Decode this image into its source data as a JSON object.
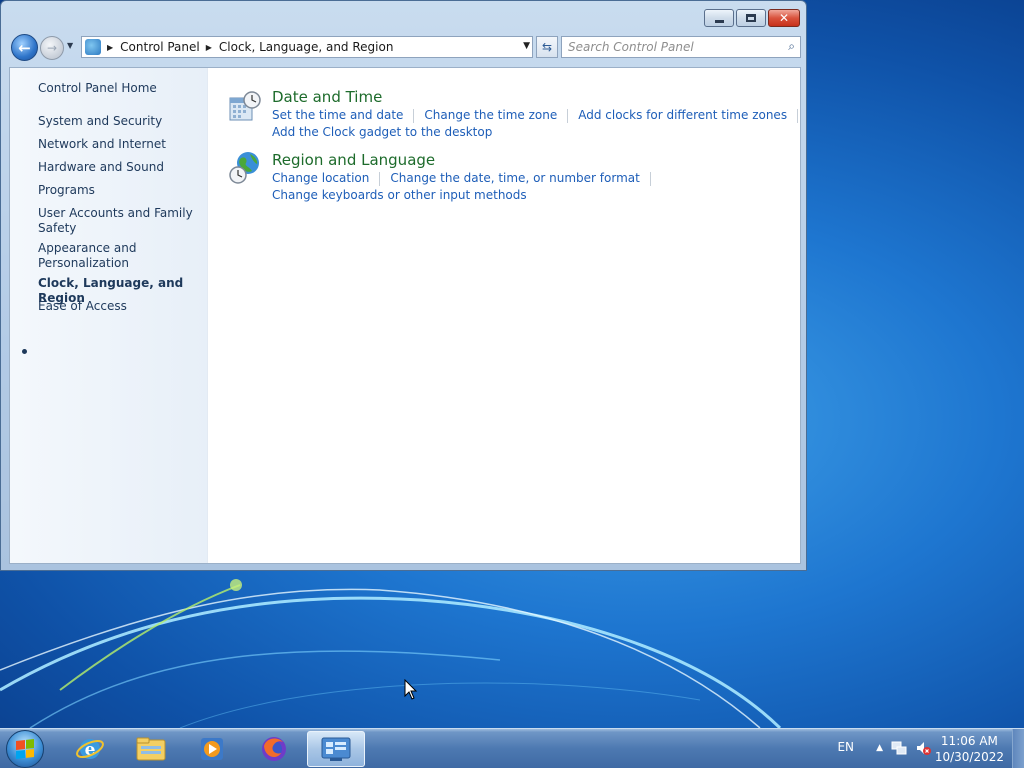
{
  "window": {
    "caption": {
      "minimize": "",
      "maximize": "",
      "close": "✕"
    }
  },
  "navbar": {
    "back_icon": "back-arrow-icon",
    "forward_icon": "forward-arrow-icon",
    "breadcrumb": [
      "Control Panel",
      "Clock, Language, and Region"
    ],
    "search_placeholder": "Search Control Panel"
  },
  "sidebar": {
    "home": "Control Panel Home",
    "items": [
      {
        "label": "System and Security"
      },
      {
        "label": "Network and Internet"
      },
      {
        "label": "Hardware and Sound"
      },
      {
        "label": "Programs"
      },
      {
        "label": "User Accounts and Family Safety"
      },
      {
        "label": "Appearance and Personalization"
      },
      {
        "label": "Clock, Language, and Region",
        "active": true
      },
      {
        "label": "Ease of Access"
      }
    ]
  },
  "sections": [
    {
      "title": "Date and Time",
      "icon": "calendar-clock-icon",
      "links": [
        [
          "Set the time and date",
          "Change the time zone",
          "Add clocks for different time zones"
        ],
        [
          "Add the Clock gadget to the desktop"
        ]
      ]
    },
    {
      "title": "Region and Language",
      "icon": "globe-clock-icon",
      "links": [
        [
          "Change location",
          "Change the date, time, or number format"
        ],
        [
          "Change keyboards or other input methods"
        ]
      ]
    }
  ],
  "taskbar": {
    "apps": [
      "internet-explorer-icon",
      "windows-explorer-icon",
      "media-player-icon",
      "firefox-icon",
      "control-panel-icon"
    ],
    "language": "EN",
    "time": "11:06 AM",
    "date": "10/30/2022"
  },
  "colors": {
    "link": "#1e5eb8",
    "section_title": "#1d6b2b",
    "sidebar_text": "#1e395b"
  }
}
